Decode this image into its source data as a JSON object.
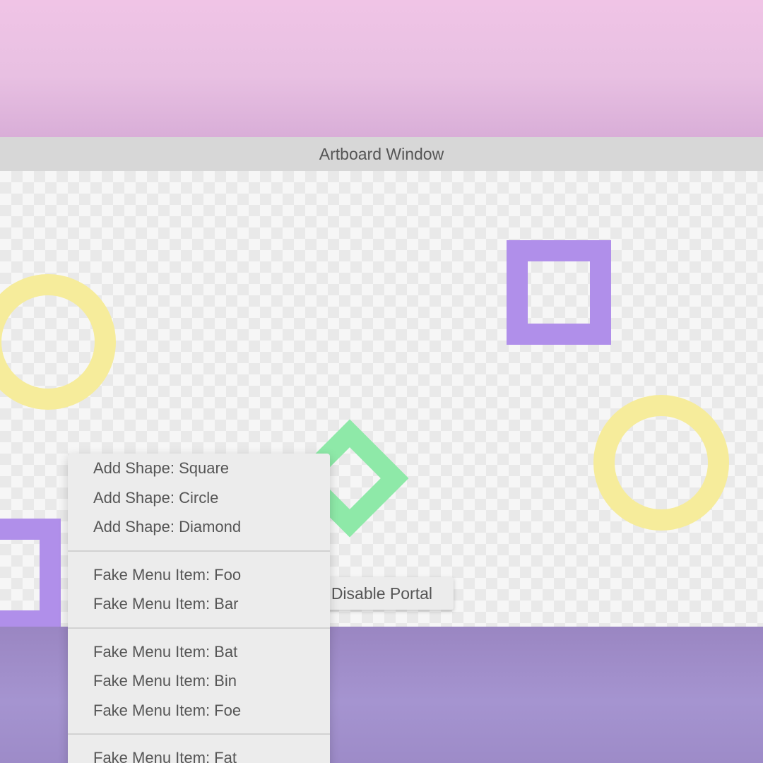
{
  "window": {
    "title": "Artboard Window"
  },
  "portal_button": {
    "label": "Disable Portal"
  },
  "context_menu": {
    "groups": [
      [
        "Add Shape: Square",
        "Add Shape: Circle",
        "Add Shape: Diamond"
      ],
      [
        "Fake Menu Item: Foo",
        "Fake Menu Item: Bar"
      ],
      [
        "Fake Menu Item: Bat",
        "Fake Menu Item: Bin",
        "Fake Menu Item: Foe"
      ],
      [
        "Fake Menu Item: Fat"
      ]
    ]
  },
  "colors": {
    "square": "#b08fea",
    "circle": "#f6ec9b",
    "diamond": "#8ee9a8"
  }
}
